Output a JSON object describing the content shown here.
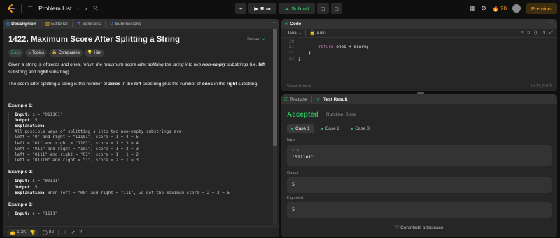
{
  "topbar": {
    "problem_list": "Problem List",
    "run": "Run",
    "submit": "Submit",
    "streak": "20",
    "premium": "Premium"
  },
  "description_panel": {
    "tabs": [
      "Description",
      "Editorial",
      "Solutions",
      "Submissions"
    ],
    "title": "1422. Maximum Score After Splitting a String",
    "solved": "Solved",
    "chips": [
      "Easy",
      "Topics",
      "Companies",
      "Hint"
    ],
    "para1": {
      "a": "Given a string ",
      "code": "s",
      "b": " of zeros and ones, ",
      "italic": "return the maximum score after splitting the string into two ",
      "bold_nonempty": "non-empty",
      "italic2": " substrings",
      "c": " (i.e. ",
      "bold_left": "left",
      "d": " substring and ",
      "bold_right": "right",
      "e": " substring)."
    },
    "para2": {
      "a": "The score after splitting a string is the number of ",
      "bold_zeros": "zeros",
      "b": " in the ",
      "bold_left": "left",
      "c": " substring plus the number of ",
      "bold_ones": "ones",
      "d": " in the ",
      "bold_right": "right",
      "e": " substring."
    },
    "example1": {
      "heading": "Example 1:",
      "input_label": "Input:",
      "input": " s = \"011101\"",
      "output_label": "Output:",
      "output": " 5",
      "explanation_label": "Explanation:",
      "lines": [
        "All possible ways of splitting s into two non-empty substrings are:",
        "left = \"0\" and right = \"11101\", score = 1 + 4 = 5",
        "left = \"01\" and right = \"1101\", score = 1 + 3 = 4",
        "left = \"011\" and right = \"101\", score = 1 + 2 = 3",
        "left = \"0111\" and right = \"01\", score = 1 + 1 = 2",
        "left = \"01110\" and right = \"1\", score = 2 + 1 = 3"
      ]
    },
    "example2": {
      "heading": "Example 2:",
      "input_label": "Input:",
      "input": " s = \"00111\"",
      "output_label": "Output:",
      "output": " 5",
      "explanation_label": "Explanation:",
      "explanation": " When left = \"00\" and right = \"111\", we get the maximum score = 2 + 3 = 5"
    },
    "example3": {
      "heading": "Example 3:",
      "input_label": "Input:",
      "input": " s = \"1111\""
    },
    "footer": {
      "likes": "1.2K",
      "comments": "82"
    }
  },
  "code_panel": {
    "tab": "Code",
    "language": "Java",
    "mode": "Auto",
    "lines": [
      {
        "n": "20",
        "text": ""
      },
      {
        "n": "21",
        "kw": "return",
        "text": " ones + score;"
      },
      {
        "n": "22",
        "text": "    }"
      },
      {
        "n": "23",
        "text": "}"
      }
    ],
    "saved": "Saved to local",
    "position": "Ln 23, Col 2"
  },
  "test_panel": {
    "tabs": [
      "Testcase",
      "Test Result"
    ],
    "status": "Accepted",
    "runtime": "Runtime: 0 ms",
    "cases": [
      "Case 1",
      "Case 2",
      "Case 3"
    ],
    "input_label": "Input",
    "input_var": "s =",
    "input_value": "\"011101\"",
    "output_label": "Output",
    "output_value": "5",
    "expected_label": "Expected",
    "expected_value": "5",
    "contribute": "Contribute a testcase"
  }
}
